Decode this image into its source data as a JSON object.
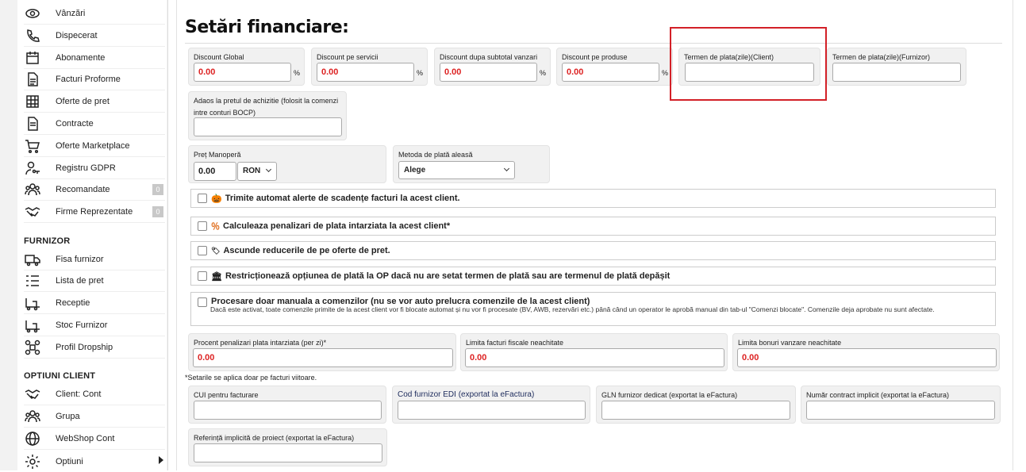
{
  "sidebar": {
    "items": [
      {
        "label": "Vânzări",
        "icon": "eye-icon"
      },
      {
        "label": "Dispecerat",
        "icon": "phone-icon"
      },
      {
        "label": "Abonamente",
        "icon": "calendar-icon"
      },
      {
        "label": "Facturi Proforme",
        "icon": "document-icon"
      },
      {
        "label": "Oferte de pret",
        "icon": "grid-icon"
      },
      {
        "label": "Contracte",
        "icon": "contract-icon"
      },
      {
        "label": "Oferte Marketplace",
        "icon": "cart-icon"
      },
      {
        "label": "Registru GDPR",
        "icon": "user-key-icon"
      },
      {
        "label": "Recomandate",
        "icon": "group-icon",
        "badge": "0"
      },
      {
        "label": "Firme Reprezentate",
        "icon": "handshake-icon",
        "badge": "0"
      }
    ],
    "section_furnizor": "FURNIZOR",
    "furnizor_items": [
      {
        "label": "Fisa furnizor",
        "icon": "truck-icon"
      },
      {
        "label": "Lista de pret",
        "icon": "list-icon"
      },
      {
        "label": "Receptie",
        "icon": "forklift-icon"
      },
      {
        "label": "Stoc Furnizor",
        "icon": "forklift-icon"
      },
      {
        "label": "Profil Dropship",
        "icon": "drone-icon"
      }
    ],
    "section_optiuni": "OPTIUNI CLIENT",
    "optiuni_items": [
      {
        "label": "Client: Cont",
        "icon": "handshake-icon"
      },
      {
        "label": "Grupa",
        "icon": "group-icon"
      },
      {
        "label": "WebShop Cont",
        "icon": "globe-icon"
      },
      {
        "label": "Optiuni",
        "icon": "gear-icon"
      }
    ]
  },
  "page": {
    "title": "Setări financiare:"
  },
  "discounts": [
    {
      "label": "Discount Global",
      "value": "0.00",
      "unit": "%"
    },
    {
      "label": "Discount pe servicii",
      "value": "0.00",
      "unit": "%"
    },
    {
      "label": "Discount dupa subtotal vanzari",
      "value": "0.00",
      "unit": "%"
    },
    {
      "label": "Discount pe produse",
      "value": "0.00",
      "unit": "%"
    }
  ],
  "terms": {
    "client_label": "Termen de plata(zile)(Client)",
    "client_value": "",
    "supplier_label": "Termen de plata(zile)(Furnizor)",
    "supplier_value": ""
  },
  "adaos": {
    "label_line1": "Adaos la pretul de achizitie (folosit la comenzi",
    "label_line2": "intre conturi BOCP)",
    "value": ""
  },
  "manopera": {
    "label": "Preț Manoperă",
    "value": "0.00",
    "currency": "RON"
  },
  "payment_method": {
    "label": "Metoda de plată aleasă",
    "value": "Alege"
  },
  "checkboxes": [
    {
      "emoji": "🎃",
      "label": "Trimite automat alerte de scadențe facturi la acest client."
    },
    {
      "emoji": "％",
      "label": "Calculeaza penalizari de plata intarziata la acest client*"
    },
    {
      "emoji": "🏷",
      "label": "Ascunde reducerile de pe oferte de pret."
    },
    {
      "emoji": "🏛",
      "label": "Restricționează opțiunea de plată la OP dacă nu are setat termen de plată sau are termenul de plată depășit"
    }
  ],
  "manual_orders": {
    "label": "Procesare doar manuala a comenzilor (nu se vor auto prelucra comenzile de la acest client)",
    "description": "Dacă este activat, toate comenzile primite de la acest client vor fi blocate automat și nu vor fi procesate (BV, AWB, rezervări etc.) până când un operator le aprobă manual din tab-ul \"Comenzi blocate\". Comenzile deja aprobate nu sunt afectate."
  },
  "penalties": [
    {
      "label": "Procent penalizari plata intarziata (per zi)*",
      "value": "0.00"
    },
    {
      "label": "Limita facturi fiscale neachitate",
      "value": "0.00"
    },
    {
      "label": "Limita bonuri vanzare neachitate",
      "value": "0.00"
    }
  ],
  "note": "*Setarile se aplica doar pe facturi viitoare.",
  "einvoice": [
    {
      "label": "CUI pentru facturare",
      "value": "",
      "accent": false
    },
    {
      "label": "Cod furnizor EDI (exportat la eFactura)",
      "value": "",
      "accent": true
    },
    {
      "label": "GLN furnizor dedicat (exportat la eFactura)",
      "value": "",
      "accent": false
    },
    {
      "label": "Număr contract implicit (exportat la eFactura)",
      "value": "",
      "accent": false
    }
  ],
  "project_ref": {
    "label": "Referință implicită de proiect (exportat la eFactura)",
    "value": ""
  },
  "colors": {
    "value_red": "#dd2222",
    "highlight_red": "#d32027",
    "accent_navy": "#1d2b5c"
  }
}
